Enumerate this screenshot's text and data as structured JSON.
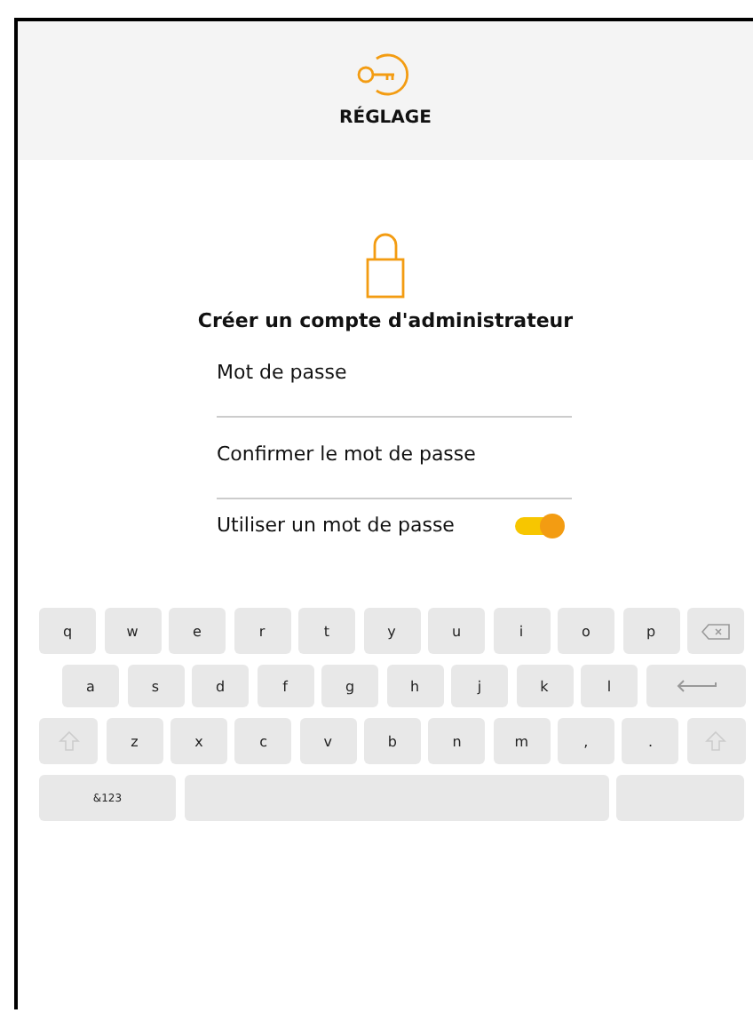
{
  "header": {
    "title": "RÉGLAGE"
  },
  "form": {
    "heading": "Créer un compte d'administrateur",
    "fields": [
      {
        "placeholder": "Mot de passe"
      },
      {
        "placeholder": "Confirmer le mot de passe"
      }
    ],
    "toggle": {
      "label": "Utiliser un mot de passe",
      "on": true
    }
  },
  "keyboard": {
    "rows": [
      [
        {
          "kind": "char",
          "label": "q"
        },
        {
          "kind": "char",
          "label": "w"
        },
        {
          "kind": "char",
          "label": "e"
        },
        {
          "kind": "char",
          "label": "r"
        },
        {
          "kind": "char",
          "label": "t"
        },
        {
          "kind": "char",
          "label": "y"
        },
        {
          "kind": "char",
          "label": "u"
        },
        {
          "kind": "char",
          "label": "i"
        },
        {
          "kind": "char",
          "label": "o"
        },
        {
          "kind": "char",
          "label": "p"
        },
        {
          "kind": "backspace"
        }
      ],
      [
        {
          "kind": "char",
          "label": "a"
        },
        {
          "kind": "char",
          "label": "s"
        },
        {
          "kind": "char",
          "label": "d"
        },
        {
          "kind": "char",
          "label": "f"
        },
        {
          "kind": "char",
          "label": "g"
        },
        {
          "kind": "char",
          "label": "h"
        },
        {
          "kind": "char",
          "label": "j"
        },
        {
          "kind": "char",
          "label": "k"
        },
        {
          "kind": "char",
          "label": "l"
        },
        {
          "kind": "enter"
        }
      ],
      [
        {
          "kind": "shift"
        },
        {
          "kind": "char",
          "label": "z"
        },
        {
          "kind": "char",
          "label": "x"
        },
        {
          "kind": "char",
          "label": "c"
        },
        {
          "kind": "char",
          "label": "v"
        },
        {
          "kind": "char",
          "label": "b"
        },
        {
          "kind": "char",
          "label": "n"
        },
        {
          "kind": "char",
          "label": "m"
        },
        {
          "kind": "char",
          "label": ","
        },
        {
          "kind": "char",
          "label": "."
        },
        {
          "kind": "shift"
        }
      ],
      [
        {
          "kind": "mode",
          "label": "&123"
        },
        {
          "kind": "space"
        },
        {
          "kind": "blank"
        }
      ]
    ]
  }
}
